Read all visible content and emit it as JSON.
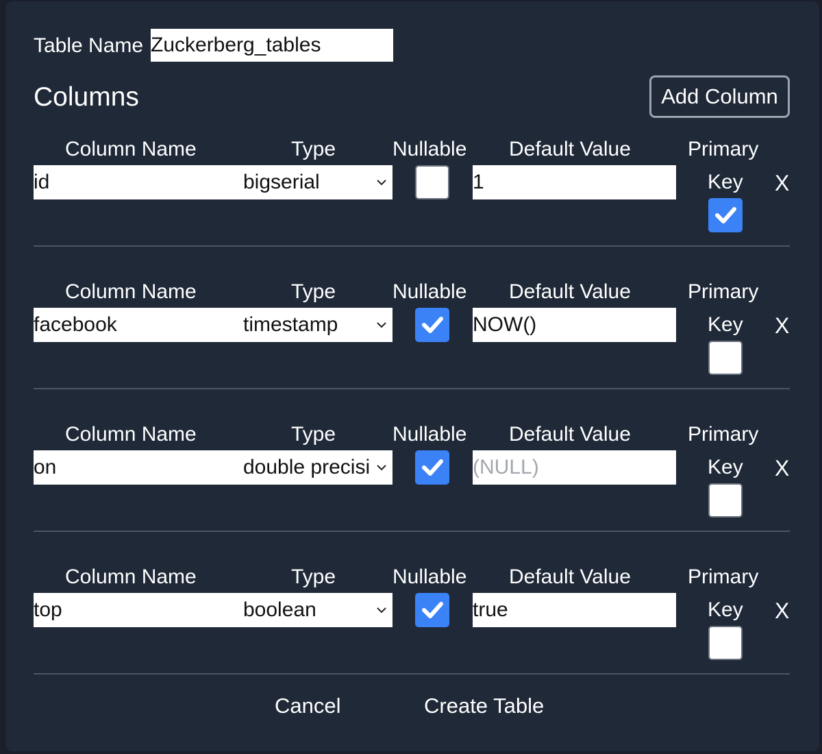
{
  "table_name": {
    "label": "Table Name",
    "value": "Zuckerberg_tables"
  },
  "columns_section": {
    "title": "Columns",
    "add_button": "Add Column"
  },
  "headers": {
    "column_name": "Column Name",
    "type": "Type",
    "nullable": "Nullable",
    "default_value": "Default Value",
    "primary": "Primary",
    "key": "Key",
    "remove": "X"
  },
  "rows": [
    {
      "name": "id",
      "type": "bigserial",
      "nullable": false,
      "default": "1",
      "default_is_placeholder": false,
      "primary_key": true
    },
    {
      "name": "facebook",
      "type": "timestamp",
      "nullable": true,
      "default": "NOW()",
      "default_is_placeholder": false,
      "primary_key": false
    },
    {
      "name": "on",
      "type": "double precisi",
      "nullable": true,
      "default": "(NULL)",
      "default_is_placeholder": true,
      "primary_key": false
    },
    {
      "name": "top",
      "type": "boolean",
      "nullable": true,
      "default": "true",
      "default_is_placeholder": false,
      "primary_key": false
    }
  ],
  "footer": {
    "cancel": "Cancel",
    "create": "Create Table"
  },
  "colors": {
    "accent": "#3b82f6",
    "panel": "#1f2937",
    "divider": "#4b5563"
  }
}
